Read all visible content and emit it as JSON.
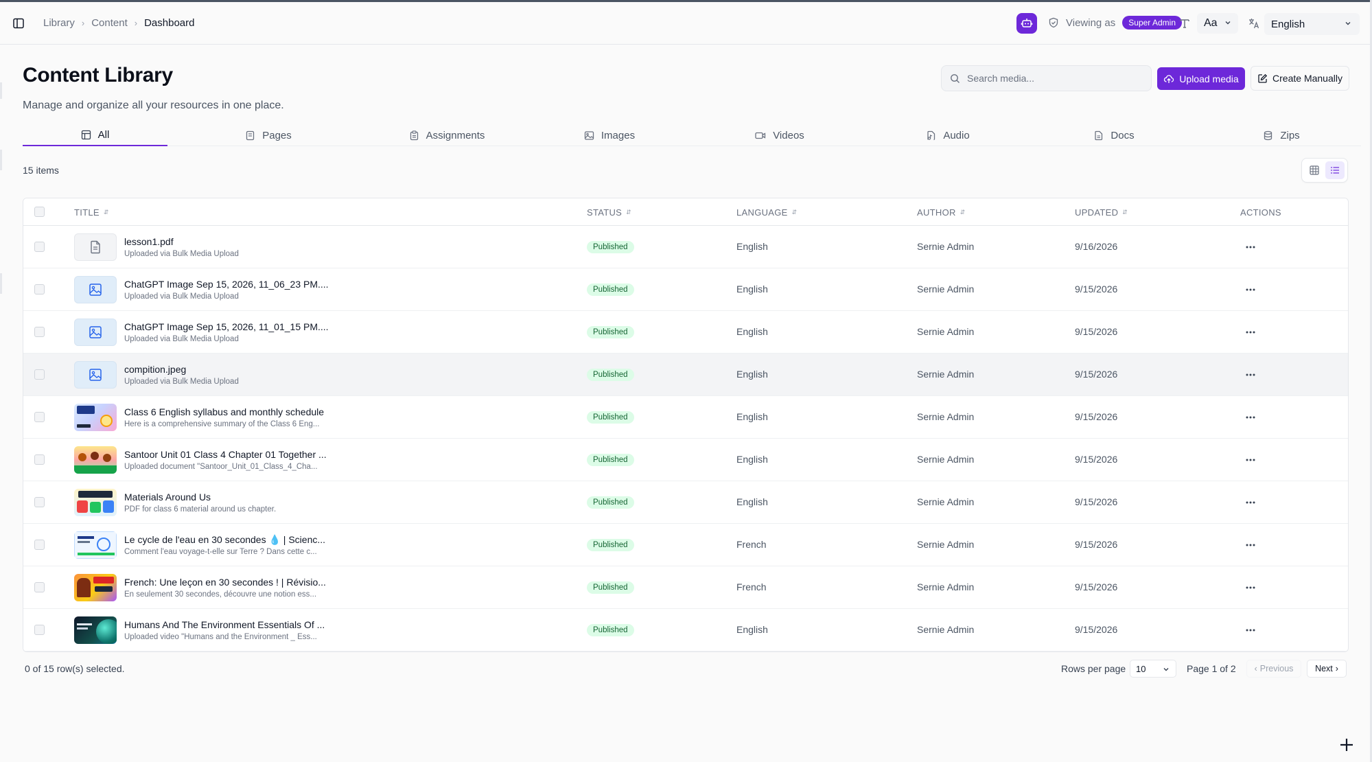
{
  "breadcrumb": [
    "Library",
    "Content",
    "Dashboard"
  ],
  "topbar": {
    "viewing_label": "Viewing as",
    "role": "Super Admin",
    "font_size_label": "Aa",
    "language": "English"
  },
  "header": {
    "title": "Content Library",
    "subtitle": "Manage and organize all your resources in one place.",
    "search_placeholder": "Search media...",
    "upload_label": "Upload media",
    "create_label": "Create Manually"
  },
  "tabs": [
    {
      "label": "All",
      "icon": "layout-icon"
    },
    {
      "label": "Pages",
      "icon": "book-icon"
    },
    {
      "label": "Assignments",
      "icon": "clipboard-icon"
    },
    {
      "label": "Images",
      "icon": "image-icon"
    },
    {
      "label": "Videos",
      "icon": "video-icon"
    },
    {
      "label": "Audio",
      "icon": "audio-file-icon"
    },
    {
      "label": "Docs",
      "icon": "document-icon"
    },
    {
      "label": "Zips",
      "icon": "database-icon"
    }
  ],
  "items_count": "15 items",
  "table": {
    "columns": [
      "TITLE",
      "STATUS",
      "LANGUAGE",
      "AUTHOR",
      "UPDATED",
      "ACTIONS"
    ],
    "rows": [
      {
        "title": "lesson1.pdf",
        "subtitle": "Uploaded via Bulk Media Upload",
        "status": "Published",
        "language": "English",
        "author": "Sernie Admin",
        "updated": "9/16/2026",
        "thumb": "doc"
      },
      {
        "title": "ChatGPT Image Sep 15, 2026, 11_06_23 PM....",
        "subtitle": "Uploaded via Bulk Media Upload",
        "status": "Published",
        "language": "English",
        "author": "Sernie Admin",
        "updated": "9/15/2026",
        "thumb": "image"
      },
      {
        "title": "ChatGPT Image Sep 15, 2026, 11_01_15 PM....",
        "subtitle": "Uploaded via Bulk Media Upload",
        "status": "Published",
        "language": "English",
        "author": "Sernie Admin",
        "updated": "9/15/2026",
        "thumb": "image"
      },
      {
        "title": "compition.jpeg",
        "subtitle": "Uploaded via Bulk Media Upload",
        "status": "Published",
        "language": "English",
        "author": "Sernie Admin",
        "updated": "9/15/2026",
        "thumb": "image"
      },
      {
        "title": "Class 6 English syllabus and monthly schedule",
        "subtitle": "Here is a comprehensive summary of the Class 6 Eng...",
        "status": "Published",
        "language": "English",
        "author": "Sernie Admin",
        "updated": "9/15/2026",
        "thumb": "ncert"
      },
      {
        "title": "Santoor Unit 01 Class 4 Chapter 01 Together ...",
        "subtitle": "Uploaded document \"Santoor_Unit_01_Class_4_Cha...",
        "status": "Published",
        "language": "English",
        "author": "Sernie Admin",
        "updated": "9/15/2026",
        "thumb": "kids"
      },
      {
        "title": "Materials Around Us",
        "subtitle": "PDF for class 6 material around us chapter.",
        "status": "Published",
        "language": "English",
        "author": "Sernie Admin",
        "updated": "9/15/2026",
        "thumb": "materials"
      },
      {
        "title": "Le cycle de l'eau en 30 secondes 💧 | Scienc...",
        "subtitle": "Comment l'eau voyage-t-elle sur Terre ? Dans cette c...",
        "status": "Published",
        "language": "French",
        "author": "Sernie Admin",
        "updated": "9/15/2026",
        "thumb": "water"
      },
      {
        "title": "French: Une leçon en 30 secondes ! | Révisio...",
        "subtitle": "En seulement 30 secondes, découvre une notion ess...",
        "status": "Published",
        "language": "French",
        "author": "Sernie Admin",
        "updated": "9/15/2026",
        "thumb": "lecon"
      },
      {
        "title": "Humans And The Environment Essentials Of ...",
        "subtitle": "Uploaded video \"Humans and the Environment _ Ess...",
        "status": "Published",
        "language": "English",
        "author": "Sernie Admin",
        "updated": "9/15/2026",
        "thumb": "earth"
      }
    ]
  },
  "footer": {
    "selected": "0 of 15 row(s) selected.",
    "rows_per_page_label": "Rows per page",
    "rows_per_page": "10",
    "page_info": "Page 1 of 2",
    "prev_label": "Previous",
    "next_label": "Next"
  },
  "colors": {
    "accent": "#6d28d9",
    "status_bg": "#dcfce7",
    "status_text": "#166534"
  }
}
